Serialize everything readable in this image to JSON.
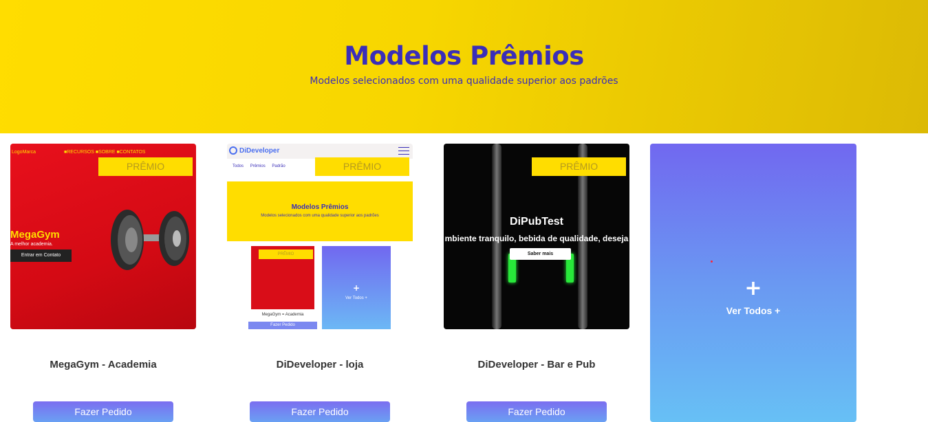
{
  "hero": {
    "title": "Modelos Prêmios",
    "subtitle": "Modelos selecionados com uma qualidade superior aos padrões",
    "colors": {
      "background": "#ffdd00",
      "text": "#3a2eb8"
    }
  },
  "cards": [
    {
      "title": "MegaGym - Academia",
      "badge": "PRÊMIO",
      "button": "Fazer Pedido",
      "preview": {
        "logo": "LogoMarca",
        "nav": "■RECURSOS ■SOBRE ■CONTATOS",
        "brand": "MegaGym",
        "tagline": "A melhor academia.",
        "cta": "Entrar em Contato"
      }
    },
    {
      "title": "DiDeveloper - loja",
      "badge": "PRÊMIO",
      "button": "Fazer Pedido",
      "preview": {
        "logo": "DiDeveloper",
        "tabs": [
          "Todos",
          "Prêmios",
          "Padrão"
        ],
        "hero_title": "Modelos Prêmios",
        "hero_subtitle": "Modelos selecionados com uma qualidade superior aos padrões",
        "mini_badge": "PRÊMIO",
        "mini_title": "MegaGym = Academia",
        "mini_button": "Fazer Pedido",
        "mini_all_plus": "+",
        "mini_all_label": "Ver Todos +"
      }
    },
    {
      "title": "DiDeveloper - Bar e Pub",
      "badge": "PRÊMIO",
      "button": "Fazer Pedido",
      "preview": {
        "title": "DiPubTest",
        "subtitle": "mbiente tranquilo, bebida de qualidade, deseja",
        "cta": "Saber mais"
      }
    }
  ],
  "view_all": {
    "plus": "+",
    "label": "Ver Todos +"
  },
  "colors": {
    "button_top": "#7b6ef0",
    "button_bottom": "#6aa0f3",
    "view_all_top": "#7168f0",
    "view_all_bottom": "#67c0f5"
  }
}
